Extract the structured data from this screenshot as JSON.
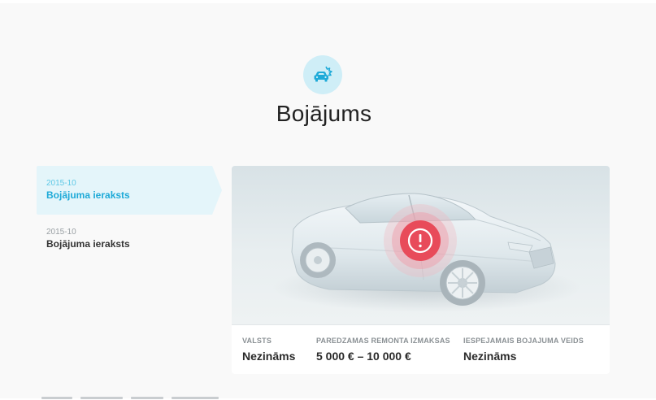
{
  "header": {
    "icon": "car-damage-icon",
    "title": "Bojājums"
  },
  "records": [
    {
      "date": "2015-10",
      "title": "Bojājuma ieraksts",
      "active": true
    },
    {
      "date": "2015-10",
      "title": "Bojājuma ieraksts",
      "active": false
    }
  ],
  "card": {
    "visual": {
      "car": "car-icon",
      "marker": "alert-icon"
    },
    "stats": {
      "country": {
        "label": "VALSTS",
        "value": "Nezināms"
      },
      "repair_cost": {
        "label": "PAREDZAMAS REMONTA IZMAKSAS",
        "value": "5 000 € – 10 000 €"
      },
      "damage_type": {
        "label": "IESPEJAMAIS BOJAJUMA VEIDS",
        "value": "Nezināms"
      }
    }
  },
  "colors": {
    "accent": "#1eaad8",
    "accent_light": "#e4f5fa",
    "alert": "#e84b5a"
  }
}
